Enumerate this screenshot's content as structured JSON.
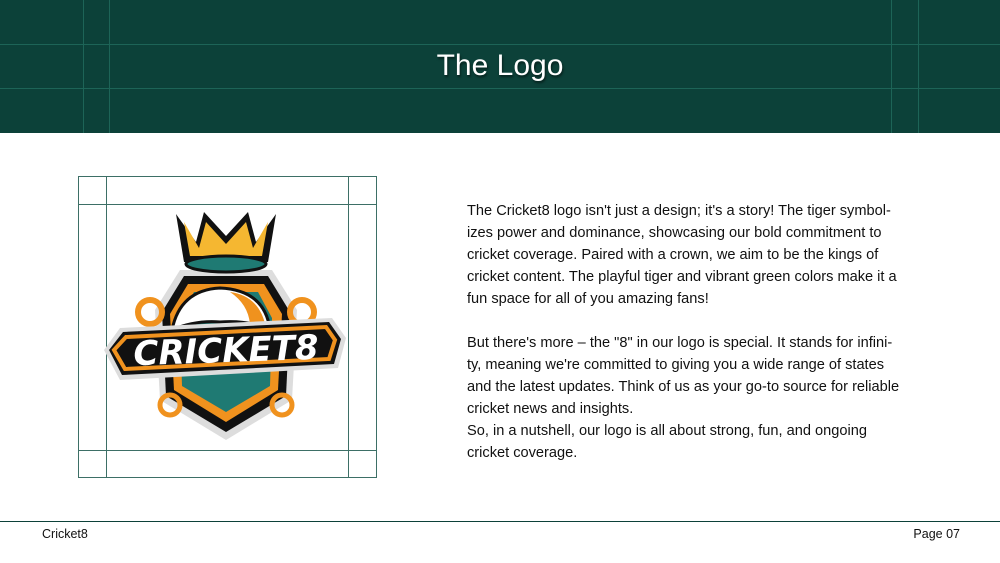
{
  "header": {
    "title": "The Logo"
  },
  "logo": {
    "wordmark": "CRICKET8"
  },
  "body": {
    "paragraph1": [
      "The Cricket8 logo isn't just a design; it's a story!  The tiger symbol-",
      "izes power and dominance, showcasing our bold commitment to",
      "cricket coverage. Paired with a crown, we aim to be the kings of",
      "cricket content. The playful tiger and vibrant green colors make it a",
      "fun space for all of you amazing fans!"
    ],
    "paragraph2": [
      "But there's more – the \"8\" in our logo is special. It stands for infini-",
      "ty, meaning we're committed to giving you a wide range of states",
      "and the latest updates. Think of us as your go-to source for reliable",
      "cricket news and insights.",
      "So, in a nutshell, our logo is all about strong, fun, and ongoing",
      "cricket coverage."
    ]
  },
  "footer": {
    "brand": "Cricket8",
    "page": "Page 07"
  },
  "colors": {
    "primary": "#0c4139",
    "orange": "#f0921e",
    "gold": "#f5b731",
    "teal": "#1f7a73"
  }
}
